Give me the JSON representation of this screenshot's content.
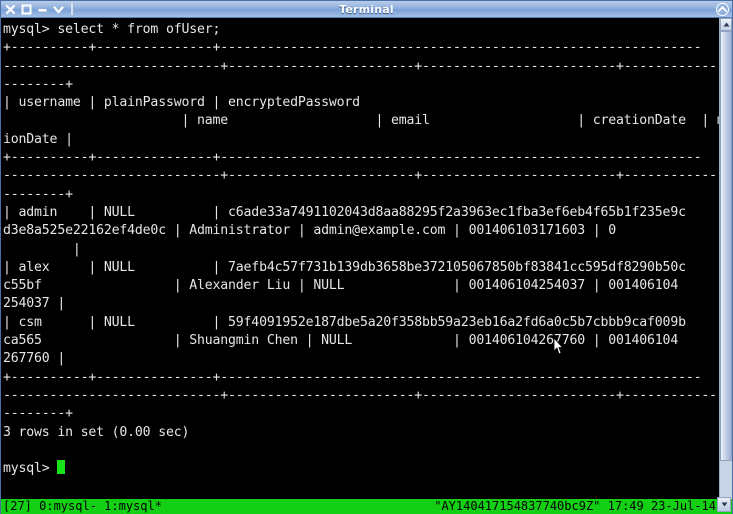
{
  "window": {
    "title": "Terminal",
    "buttons": [
      {
        "name": "close-button",
        "glyph": "✕"
      },
      {
        "name": "maximize-button",
        "glyph": "❐"
      },
      {
        "name": "minimize-button",
        "glyph": "—"
      },
      {
        "name": "window-menu-button",
        "glyph": "⌄"
      }
    ],
    "collapse_icon": "⌃"
  },
  "terminal": {
    "prompt_command": "mysql> select * from ofUser;",
    "lines": [
      "mysql> select * from ofUser;",
      "+----------+---------------+--------------------------------------------------------------",
      "----------------------------+------------------------+-------------------------+---------------+-------",
      "--------+",
      "| username | plainPassword | encryptedPassword",
      "                       | name                   | email                   | creationDate  | modificat",
      "ionDate |",
      "+----------+---------------+--------------------------------------------------------------",
      "----------------------------+------------------------+-------------------------+---------------+-------",
      "--------+",
      "| admin    | NULL          | c6ade33a7491102043d8aa88295f2a3963ec1fba3ef6eb4f65b1f235e9c",
      "d3e8a525e22162ef4de0c | Administrator | admin@example.com | 001406103171603 | 0",
      "         |",
      "| alex     | NULL          | 7aefb4c57f731b139db3658be372105067850bf83841cc595df8290b50c",
      "c55bf                 | Alexander Liu | NULL              | 001406104254037 | 001406104",
      "254037 |",
      "| csm      | NULL          | 59f4091952e187dbe5a20f358bb59a23eb16a2fd6a0c5b7cbbb9caf009b",
      "ca565                 | Shuangmin Chen | NULL             | 001406104267760 | 001406104",
      "267760 |",
      "+----------+---------------+--------------------------------------------------------------",
      "----------------------------+------------------------+-------------------------+---------------+-------",
      "--------+",
      "3 rows in set (0.00 sec)",
      "",
      "mysql> "
    ],
    "result_summary": "3 rows in set (0.00 sec)",
    "final_prompt": "mysql> ",
    "table": {
      "columns": [
        "username",
        "plainPassword",
        "encryptedPassword",
        "name",
        "email",
        "creationDate",
        "modificationDate"
      ],
      "rows": [
        {
          "username": "admin",
          "plainPassword": "NULL",
          "encryptedPassword": "c6ade33a7491102043d8aa88295f2a3963ec1fba3ef6eb4f65b1f235e9cd3e8a525e22162ef4de0c",
          "name": "Administrator",
          "email": "admin@example.com",
          "creationDate": "001406103171603",
          "modificationDate": "0"
        },
        {
          "username": "alex",
          "plainPassword": "NULL",
          "encryptedPassword": "7aefb4c57f731b139db3658be372105067850bf83841cc595df8290b50cc55bf",
          "name": "Alexander Liu",
          "email": "NULL",
          "creationDate": "001406104254037",
          "modificationDate": "001406104254037"
        },
        {
          "username": "csm",
          "plainPassword": "NULL",
          "encryptedPassword": "59f4091952e187dbe5a20f358bb59a23eb16a2fd6a0c5b7cbbb9caf009bca565",
          "name": "Shuangmin Chen",
          "email": "NULL",
          "creationDate": "001406104267760",
          "modificationDate": "001406104267760"
        }
      ]
    },
    "colors": {
      "background": "#000000",
      "foreground": "#e6e6e6",
      "cursor": "#18e018"
    }
  },
  "statusbar": {
    "session_index": "[27]",
    "windows": "0:mysql- 1:mysql*",
    "left": "[27] 0:mysql- 1:mysql*",
    "hostname": "\"AY140417154837740bc9Z\"",
    "time": "17:49",
    "date": "23-Jul-14",
    "right": "\"AY140417154837740bc9Z\" 17:49 23-Jul-14",
    "background": "#14d014",
    "foreground": "#000000"
  },
  "scrollbar": {
    "up_arrow": "▲",
    "down_arrow": "▼"
  }
}
